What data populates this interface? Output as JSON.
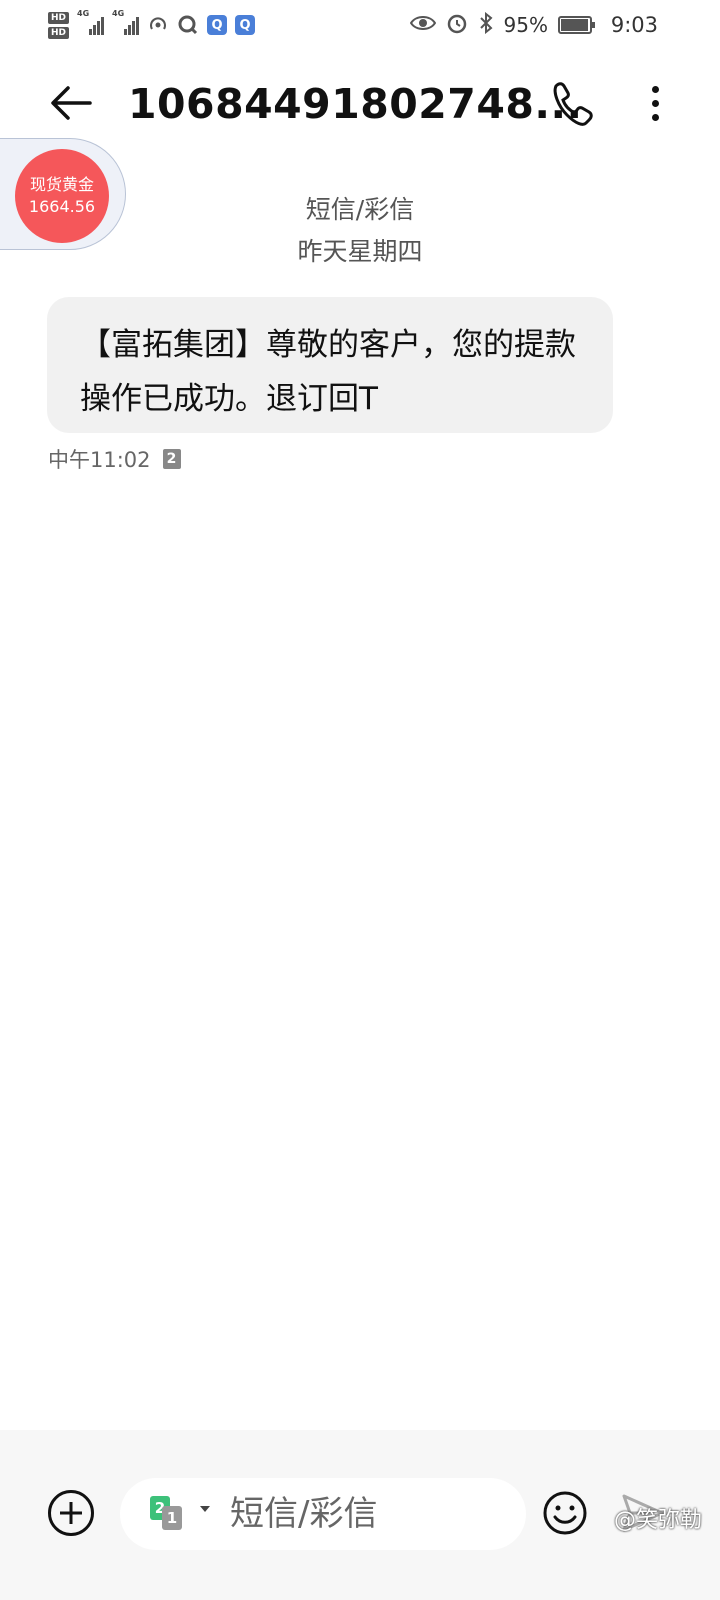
{
  "status_bar": {
    "hd1": "HD",
    "hd2": "HD",
    "net1": "4G",
    "net2": "4G",
    "battery_level": 0.95,
    "battery_text": "95%",
    "time": "9:03"
  },
  "header": {
    "title": "10684491802748..."
  },
  "gold_widget": {
    "name": "现货黄金",
    "price": "1664.56"
  },
  "conversation": {
    "type_label": "短信/彩信",
    "date_label": "昨天星期四"
  },
  "message": {
    "text": "【富拓集团】尊敬的客户，您的提款操作已成功。退订回T",
    "time": "中午11:02",
    "sim": "2"
  },
  "composer": {
    "sim_primary": "2",
    "sim_secondary": "1",
    "placeholder": "短信/彩信"
  },
  "watermark": {
    "text": "@笑弥勒"
  },
  "colors": {
    "gold_circle": "#f5575a",
    "bubble_bg": "#f1f1f1",
    "sim_green": "#3dc17a"
  }
}
